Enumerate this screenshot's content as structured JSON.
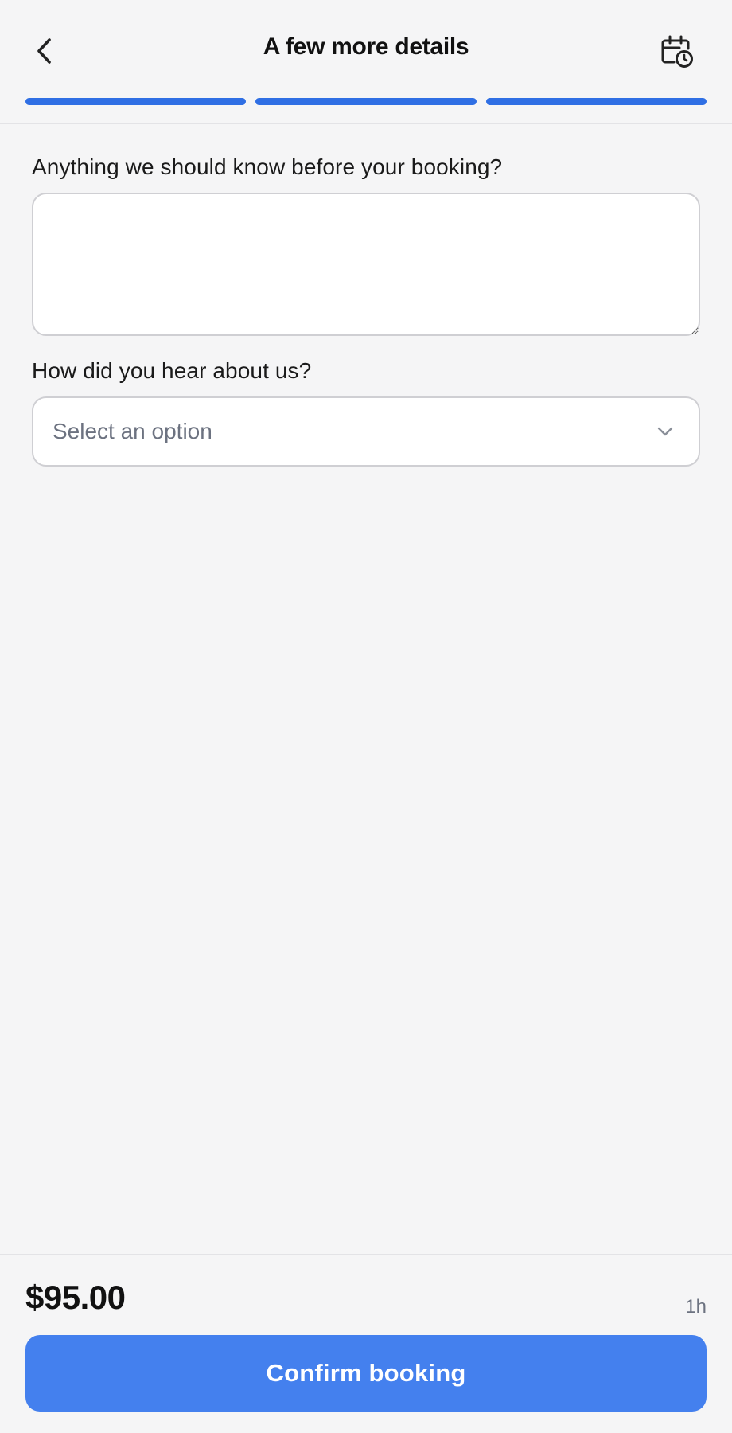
{
  "header": {
    "title": "A few more details",
    "back_icon": "chevron-left-icon",
    "calendar_icon": "calendar-clock-icon"
  },
  "progress": {
    "total_steps": 3,
    "completed_steps": 3,
    "color": "#2f6fe4"
  },
  "form": {
    "notes_label": "Anything we should know before your booking?",
    "notes_value": "",
    "source_label": "How did you hear about us?",
    "source_placeholder": "Select an option"
  },
  "footer": {
    "price": "$95.00",
    "duration": "1h",
    "confirm_label": "Confirm booking",
    "accent": "#4480ee"
  }
}
